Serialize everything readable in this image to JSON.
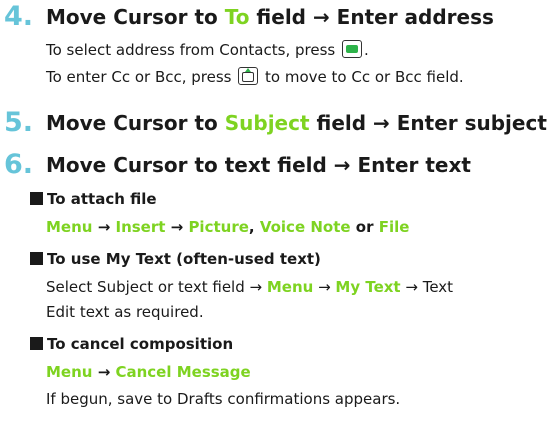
{
  "step4": {
    "num": "4.",
    "pre": "Move Cursor to ",
    "field": "To",
    "post": " field → Enter address",
    "line1_text": "To select address from Contacts, press",
    "line1_end": ".",
    "line2_pre": "To enter Cc or Bcc, press",
    "line2_post": "to move to Cc or Bcc field."
  },
  "step5": {
    "num": "5.",
    "pre": "Move Cursor to ",
    "field": "Subject",
    "post": " field → Enter subject"
  },
  "step6": {
    "num": "6.",
    "text": "Move Cursor to text field → Enter text"
  },
  "attach": {
    "heading": "To attach file",
    "menu": "Menu",
    "arrow1": " → ",
    "insert": "Insert",
    "arrow2": " → ",
    "picture": "Picture",
    "comma": ", ",
    "voice": "Voice Note",
    "or": " or ",
    "file": "File"
  },
  "mytext": {
    "heading": "To use My Text (often-used text)",
    "pre": "Select Subject or text field → ",
    "menu": "Menu",
    "arrow1": " → ",
    "mytext": "My Text",
    "post": " → Text",
    "line2": "Edit text as required."
  },
  "cancel": {
    "heading": "To cancel composition",
    "menu": "Menu",
    "arrow": " → ",
    "cancel": "Cancel Message",
    "line2": "If begun, save to Drafts confirmations appears."
  },
  "colors": {
    "step_number": "#66c4d9",
    "highlight": "#7ed321",
    "key_accent": "#2db34a"
  },
  "icons": {
    "center_key": "center-key-icon",
    "up_key": "up-key-icon",
    "bullet": "square-bullet-icon"
  }
}
